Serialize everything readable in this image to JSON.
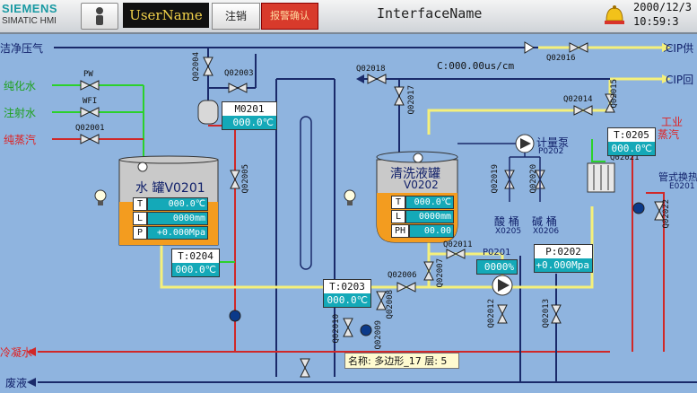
{
  "header": {
    "brand": "SIEMENS",
    "product": "SIMATIC HMI",
    "username": "UserName",
    "logout_label": "注销",
    "alarm_ack_label": "报警确认",
    "interface_name": "InterfaceName",
    "date": "2000/12/3",
    "time": "10:59:3"
  },
  "lines": {
    "clean_air": "洁净压气",
    "pure_water": "纯化水",
    "injection_water": "注射水",
    "pure_steam": "纯蒸汽",
    "condensate": "冷凝水",
    "waste": "废液",
    "cip_supply": "CIP供",
    "cip_return": "CIP回",
    "industrial_steam_1": "工业",
    "industrial_steam_2": "蒸汽"
  },
  "valves": {
    "pw": "PW",
    "wfi": "WFI",
    "q02001": "Q02001",
    "q02004": "Q02004",
    "q02003": "Q02003",
    "q02005": "Q02005",
    "q02018": "Q02018",
    "q02017": "Q02017",
    "q02016": "Q02016",
    "q02014": "Q02014",
    "q02015": "Q02015",
    "q02019": "Q02019",
    "q02020": "Q02020",
    "q02021": "Q02021",
    "q02022": "Q02022",
    "q02011": "Q02011",
    "q02007": "Q02007",
    "q02006": "Q02006",
    "q02008": "Q02008",
    "q02010": "Q02010",
    "q02009": "Q02009",
    "q02012": "Q02012",
    "q02013": "Q02013"
  },
  "conductivity": "C:000.00us/cm",
  "m0201": {
    "title": "M0201",
    "value": "000.0℃"
  },
  "t0204": {
    "title": "T:0204",
    "value": "000.0℃"
  },
  "t0203": {
    "title": "T:0203",
    "value": "000.0℃"
  },
  "t0205": {
    "title": "T:0205",
    "value": "000.0℃"
  },
  "p0202": {
    "title": "P:0202",
    "value": "+0.000Mpa"
  },
  "p0201": {
    "title": "P0201",
    "value": "0000%"
  },
  "water_tank": {
    "title": "水 罐V0201",
    "rows": [
      {
        "k": "T",
        "v": "000.0℃"
      },
      {
        "k": "L",
        "v": "0000mm"
      },
      {
        "k": "P",
        "v": "+0.000Mpa"
      }
    ]
  },
  "wash_tank": {
    "title_1": "清洗液罐",
    "title_2": "V0202",
    "rows": [
      {
        "k": "T",
        "v": "000.0℃"
      },
      {
        "k": "L",
        "v": "0000mm"
      },
      {
        "k": "PH",
        "v": "00.00"
      }
    ]
  },
  "metering_pump": {
    "name": "计量泵",
    "id": "P0202"
  },
  "acid_tank": {
    "name": "酸 桶",
    "id": "X0205"
  },
  "alkali_tank": {
    "name": "碱 桶",
    "id": "X0206"
  },
  "heat_exchanger": {
    "name": "管式换热",
    "id": "E0201"
  },
  "tooltip": {
    "name": "名称: 多边形_17",
    "layer": "层: 5"
  },
  "colors": {
    "background": "#8fb4df",
    "teal": "#14a9b8",
    "pipe_yellow": "#f5f07a",
    "pipe_green": "#2bd12b",
    "pipe_red": "#d02828",
    "pipe_dark": "#1a2a6a",
    "tank_orange": "#f39c1f"
  }
}
